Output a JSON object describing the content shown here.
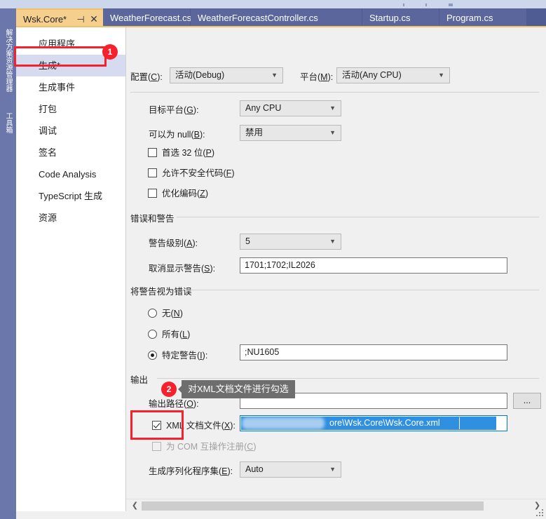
{
  "window": {
    "gutter_labels": [
      "解决方案资源管理器",
      "工具箱"
    ]
  },
  "tabs": {
    "items": [
      {
        "label": "Wsk.Core*",
        "active": true,
        "pin_icon": "⊣",
        "close_icon": "✕"
      },
      {
        "label": "WeatherForecast.cs",
        "active": false
      },
      {
        "label": "WeatherForecastController.cs",
        "active": false
      },
      {
        "label": "Startup.cs",
        "active": false
      },
      {
        "label": "Program.cs",
        "active": false
      }
    ]
  },
  "sidebar": {
    "items": [
      {
        "label": "应用程序",
        "selected": false
      },
      {
        "label": "生成*",
        "selected": true
      },
      {
        "label": "生成事件",
        "selected": false
      },
      {
        "label": "打包",
        "selected": false
      },
      {
        "label": "调试",
        "selected": false
      },
      {
        "label": "签名",
        "selected": false
      },
      {
        "label": "Code Analysis",
        "selected": false
      },
      {
        "label": "TypeScript 生成",
        "selected": false
      },
      {
        "label": "资源",
        "selected": false
      }
    ]
  },
  "header": {
    "configuration_label": "配置(C):",
    "configuration_value": "活动(Debug)",
    "platform_label": "平台(M):",
    "platform_value": "活动(Any CPU)"
  },
  "general": {
    "target_platform_label": "目标平台(G):",
    "target_platform_value": "Any CPU",
    "nullable_label": "可以为 null(B):",
    "nullable_value": "禁用",
    "checkboxes": [
      {
        "label": "首选 32 位(P)",
        "checked": false,
        "disabled": false
      },
      {
        "label": "允许不安全代码(F)",
        "checked": false,
        "disabled": false
      },
      {
        "label": "优化编码(Z)",
        "checked": false,
        "disabled": false
      }
    ]
  },
  "errors_warnings": {
    "group_title": "错误和警告",
    "warning_level_label": "警告级别(A):",
    "warning_level_value": "5",
    "suppress_warnings_label": "取消显示警告(S):",
    "suppress_warnings_value": "1701;1702;IL2026"
  },
  "warnings_as_errors": {
    "group_title": "将警告视为错误",
    "options": [
      {
        "label": "无(N)",
        "selected": false
      },
      {
        "label": "所有(L)",
        "selected": false
      },
      {
        "label": "特定警告(I):",
        "selected": true
      }
    ],
    "specific_warnings_value": ";NU1605"
  },
  "output": {
    "group_title": "输出",
    "output_path_label": "输出路径(O):",
    "output_path_value": "",
    "xml_doc_label": "XML 文档文件(X):",
    "xml_doc_checked": true,
    "xml_doc_value": "ore\\Wsk.Core\\Wsk.Core.xml",
    "com_interop_label": "为 COM 互操作注册(C)",
    "com_interop_checked": false,
    "serialization_label": "生成序列化程序集(E):",
    "serialization_value": "Auto",
    "browse_button_label": "..."
  },
  "annotations": {
    "badge_one": "1",
    "badge_two": "2",
    "tooltip_text": "对XML文档文件进行勾选",
    "highlight_color": "#f5222d"
  },
  "scrollbar": {
    "left_arrow": "❮",
    "right_arrow": "❯"
  }
}
